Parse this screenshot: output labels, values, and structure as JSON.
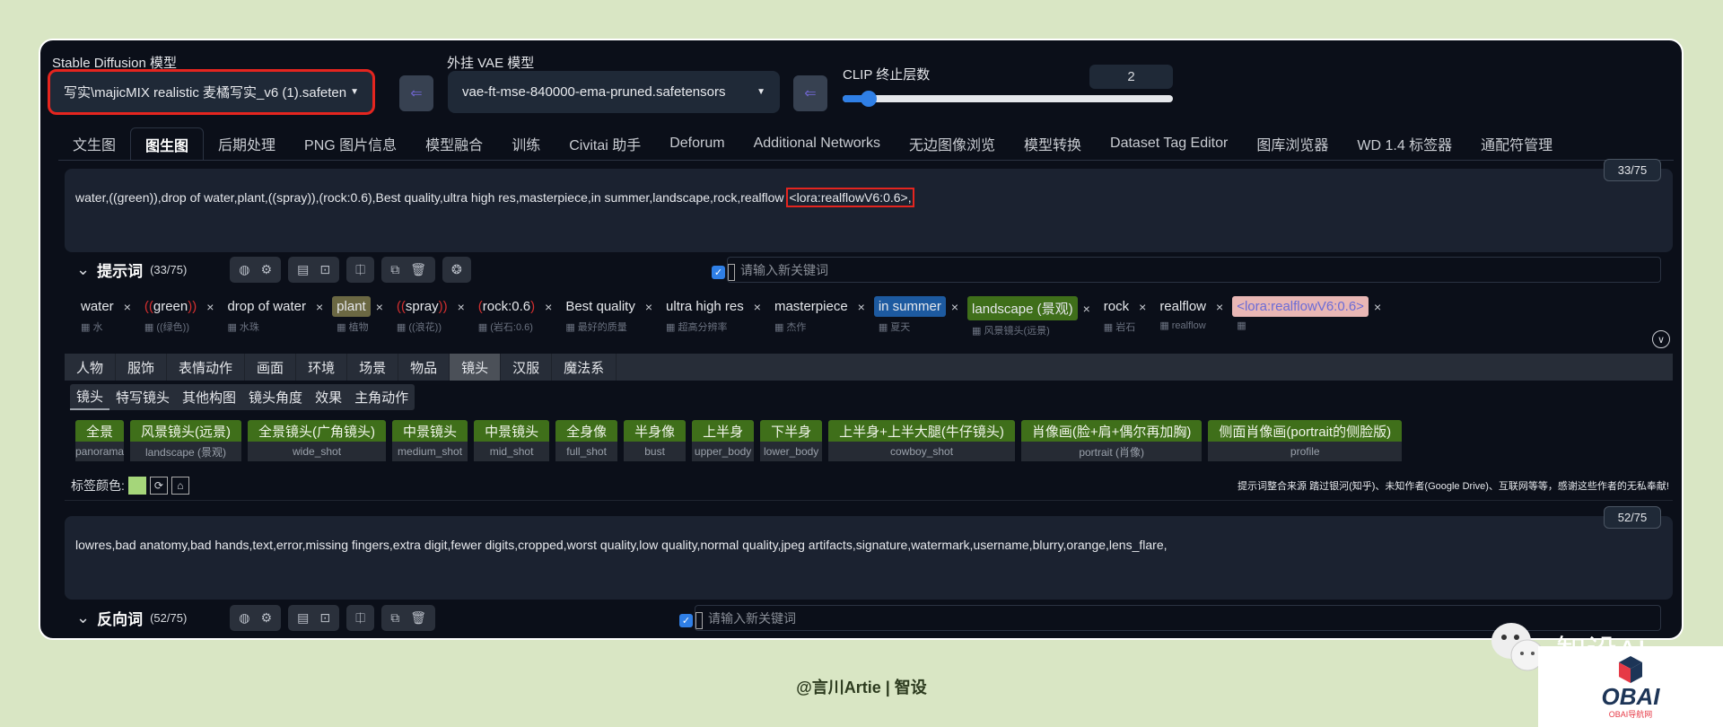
{
  "top": {
    "sd_model_label": "Stable Diffusion 模型",
    "sd_model_value": "写实\\majicMIX realistic 麦橘写实_v6 (1).safeten",
    "vae_label": "外挂 VAE 模型",
    "vae_value": "vae-ft-mse-840000-ema-pruned.safetensors",
    "clip_label": "CLIP 终止层数",
    "clip_value": "2",
    "clip_slider_fraction": 0.08,
    "refresh_icon": "refresh-arrow-icon"
  },
  "tabs": [
    "文生图",
    "图生图",
    "后期处理",
    "PNG 图片信息",
    "模型融合",
    "训练",
    "Civitai 助手",
    "Deforum",
    "Additional Networks",
    "无边图像浏览",
    "模型转换",
    "Dataset Tag Editor",
    "图库浏览器",
    "WD 1.4 标签器",
    "通配符管理"
  ],
  "active_tab": "图生图",
  "prompt": {
    "text_main": "water,((green)),drop of water,plant,((spray)),(rock:0.6),Best quality,ultra high res,masterpiece,in summer,landscape,rock,realflow ",
    "text_highlight": "<lora:realflowV6:0.6>,",
    "counter": "33/75",
    "title": "提示词",
    "count": "(33/75)",
    "keyword_placeholder": "请输入新关键词"
  },
  "tags": [
    {
      "pre": "",
      "word": "water",
      "post": "",
      "sub": "水",
      "bg": ""
    },
    {
      "pre": "((",
      "word": "green",
      "post": "))",
      "sub": "((绿色))",
      "bg": ""
    },
    {
      "pre": "",
      "word": "drop of water",
      "post": "",
      "sub": "水珠",
      "bg": ""
    },
    {
      "pre": "",
      "word": "plant",
      "post": "",
      "sub": "植物",
      "bg": "#6b6843"
    },
    {
      "pre": "((",
      "word": "spray",
      "post": "))",
      "sub": "((浪花))",
      "bg": ""
    },
    {
      "pre": "(",
      "word": "rock:0.6",
      "post": ")",
      "sub": "(岩石:0.6)",
      "bg": ""
    },
    {
      "pre": "",
      "word": "Best quality",
      "post": "",
      "sub": "最好的质量",
      "bg": ""
    },
    {
      "pre": "",
      "word": "ultra high res",
      "post": "",
      "sub": "超高分辨率",
      "bg": ""
    },
    {
      "pre": "",
      "word": "masterpiece",
      "post": "",
      "sub": "杰作",
      "bg": ""
    },
    {
      "pre": "",
      "word": "in summer",
      "post": "",
      "sub": "夏天",
      "bg": "#1d5aa0"
    },
    {
      "pre": "",
      "word": "landscape (景观)",
      "post": "",
      "sub": "风景镜头(远景)",
      "bg": "#3f6f1a"
    },
    {
      "pre": "",
      "word": "rock",
      "post": "",
      "sub": "岩石",
      "bg": ""
    },
    {
      "pre": "",
      "word": "realflow",
      "post": "",
      "sub": "realflow",
      "bg": ""
    },
    {
      "pre": "",
      "word": "<lora:realflowV6:0.6>",
      "post": "",
      "sub": "",
      "bg": "#e9b7b5"
    }
  ],
  "categories": [
    "人物",
    "服饰",
    "表情动作",
    "画面",
    "环境",
    "场景",
    "物品",
    "镜头",
    "汉服",
    "魔法系"
  ],
  "active_category": "镜头",
  "subcategories": [
    "镜头",
    "特写镜头",
    "其他构图",
    "镜头角度",
    "效果",
    "主角动作"
  ],
  "shot_buttons": [
    {
      "zh": "全景",
      "en": "panorama"
    },
    {
      "zh": "风景镜头(远景)",
      "en": "landscape (景观)"
    },
    {
      "zh": "全景镜头(广角镜头)",
      "en": "wide_shot"
    },
    {
      "zh": "中景镜头",
      "en": "medium_shot"
    },
    {
      "zh": "中景镜头",
      "en": "mid_shot"
    },
    {
      "zh": "全身像",
      "en": "full_shot"
    },
    {
      "zh": "半身像",
      "en": "bust"
    },
    {
      "zh": "上半身",
      "en": "upper_body"
    },
    {
      "zh": "下半身",
      "en": "lower_body"
    },
    {
      "zh": "上半身+上半大腿(牛仔镜头)",
      "en": "cowboy_shot"
    },
    {
      "zh": "肖像画(脸+肩+偶尔再加胸)",
      "en": "portrait (肖像)"
    },
    {
      "zh": "侧面肖像画(portrait的侧脸版)",
      "en": "profile"
    }
  ],
  "tag_color_label": "标签颜色:",
  "credit": "提示词整合来源 踏过银河(知乎)、未知作者(Google Drive)、互联网等等，感谢这些作者的无私奉献!",
  "negative": {
    "text": "lowres,bad anatomy,bad hands,text,error,missing fingers,extra digit,fewer digits,cropped,worst quality,low quality,normal quality,jpeg artifacts,signature,watermark,username,blurry,orange,lens_flare,",
    "counter": "52/75",
    "title": "反向词",
    "count": "(52/75)",
    "keyword_placeholder": "请输入新关键词"
  },
  "footer": "@言川Artie | 智设",
  "watermark": {
    "wechat_text": "智设AI",
    "logo_text": "OBAI",
    "logo_sub": "OBAI导航网"
  },
  "colors": {
    "background": "#d9e6c4",
    "panel": "#0b0f19",
    "highlight": "#e5251f",
    "tag_green": "#3f6f1a"
  }
}
